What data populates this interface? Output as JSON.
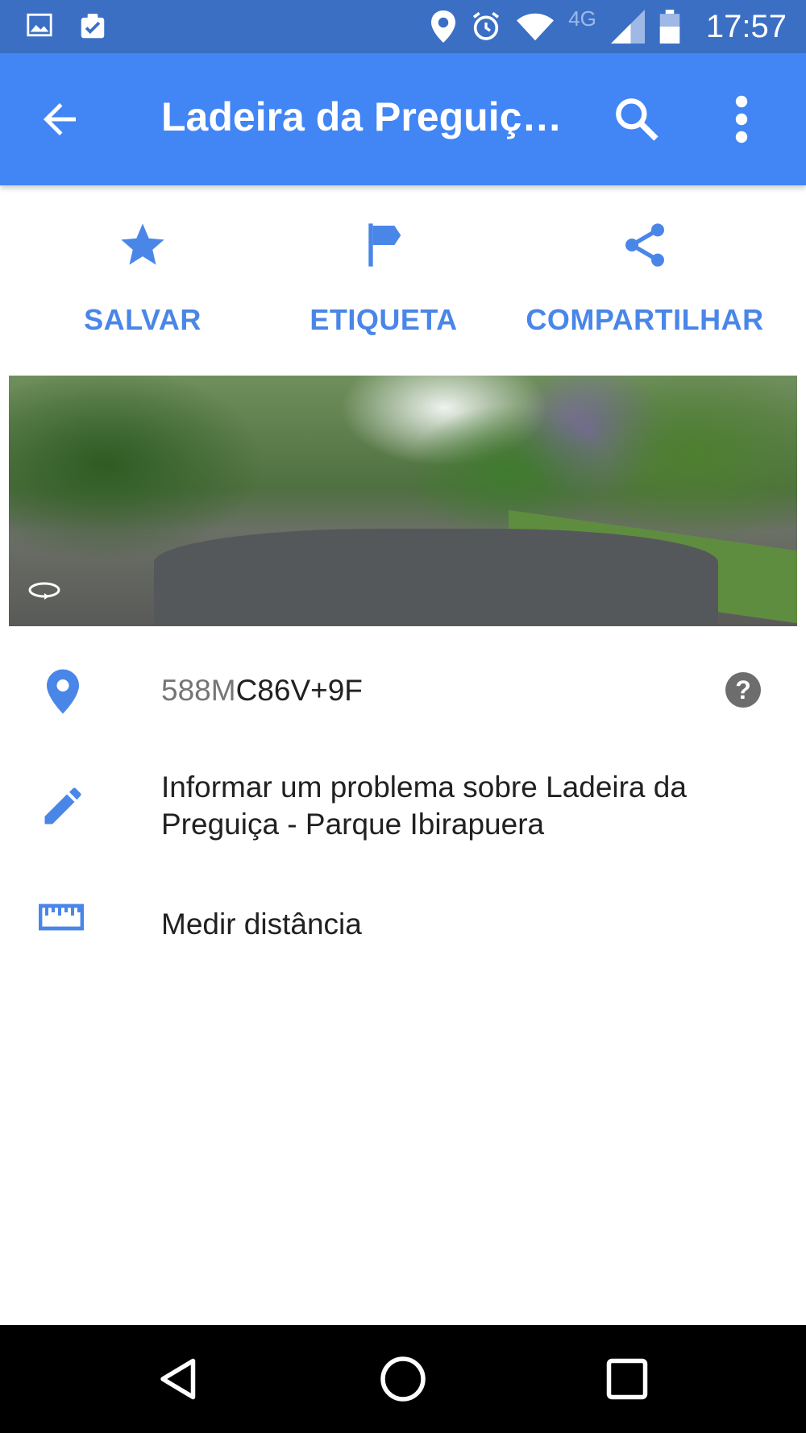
{
  "status_bar": {
    "network_label": "4G",
    "time": "17:57",
    "icons": [
      "image-notification-icon",
      "clipboard-check-icon",
      "location-icon",
      "alarm-icon",
      "wifi-icon",
      "signal-icon",
      "battery-icon"
    ]
  },
  "app_bar": {
    "title": "Ladeira da Preguiç…",
    "icons": [
      "back-arrow-icon",
      "search-icon",
      "more-vert-icon"
    ]
  },
  "actions": [
    {
      "label": "SALVAR",
      "icon": "star-icon"
    },
    {
      "label": "ETIQUETA",
      "icon": "flag-icon"
    },
    {
      "label": "COMPARTILHAR",
      "icon": "share-icon"
    }
  ],
  "photo": {
    "badge_icon": "panorama-360-icon"
  },
  "plus_code": {
    "prefix": "588M",
    "code": "C86V+9F",
    "help_icon": "help-icon"
  },
  "report": {
    "text": "Informar um problema sobre Ladeira da Preguiça - Parque Ibirapuera"
  },
  "measure": {
    "text": "Medir distância"
  },
  "colors": {
    "status_bar": "#3b6fc4",
    "app_bar": "#4285f4",
    "accent": "#4a86e8",
    "nav_bar": "#000000"
  }
}
